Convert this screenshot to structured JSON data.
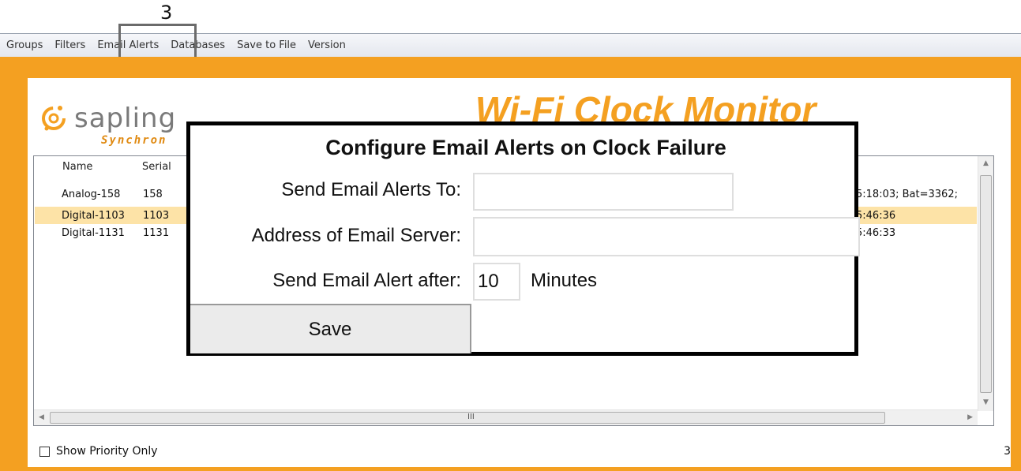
{
  "annotation": {
    "step_number": "3"
  },
  "menubar": {
    "items": [
      "Groups",
      "Filters",
      "Email Alerts",
      "Databases",
      "Save to File",
      "Version"
    ]
  },
  "branding": {
    "logo_text": "sapling",
    "logo_subtext": "Synchron",
    "app_title": "Wi-Fi Clock Monitor"
  },
  "list": {
    "columns": [
      "Name",
      "Serial"
    ],
    "rows": [
      {
        "name": "Analog-158",
        "serial": "158",
        "status": "5:18:03; Bat=3362;",
        "selected": false
      },
      {
        "name": "Digital-1103",
        "serial": "1103",
        "status": "5:46:36",
        "selected": true
      },
      {
        "name": "Digital-1131",
        "serial": "1131",
        "status": "5:46:33",
        "selected": false
      }
    ],
    "hscroll_grip": "III"
  },
  "footer": {
    "show_priority_label": "Show Priority Only",
    "show_priority_checked": false,
    "count": "3"
  },
  "dialog": {
    "title": "Configure Email Alerts on Clock Failure",
    "send_to_label": "Send Email Alerts To:",
    "send_to_value": "",
    "server_label": "Address of Email Server:",
    "server_value": "",
    "after_label": "Send Email Alert after:",
    "after_value": "10",
    "minutes_label": "Minutes",
    "save_label": "Save"
  },
  "colors": {
    "frame_orange": "#f4a021",
    "selected_row": "#fde3a7"
  }
}
